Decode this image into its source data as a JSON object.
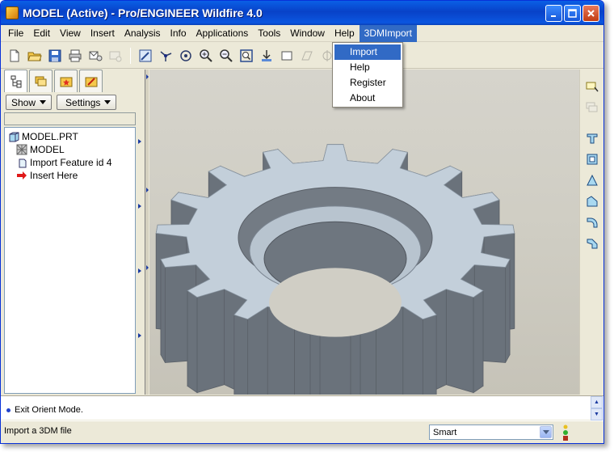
{
  "window": {
    "title": "MODEL (Active) - Pro/ENGINEER Wildfire 4.0",
    "minimize_icon": "minimize-icon",
    "maximize_icon": "maximize-icon",
    "close_icon": "close-icon"
  },
  "menubar": {
    "items": [
      "File",
      "Edit",
      "View",
      "Insert",
      "Analysis",
      "Info",
      "Applications",
      "Tools",
      "Window",
      "Help",
      "3DMImport"
    ],
    "active": "3DMImport"
  },
  "dropdown": {
    "items": [
      "Import",
      "Help",
      "Register",
      "About"
    ],
    "highlighted": "Import"
  },
  "navigator": {
    "show_label": "Show",
    "settings_label": "Settings",
    "tree": [
      {
        "label": "MODEL.PRT",
        "icon": "part-icon"
      },
      {
        "label": "MODEL",
        "icon": "layer-icon"
      },
      {
        "label": "Import Feature id 4",
        "icon": "import-feature-icon"
      },
      {
        "label": "Insert Here",
        "icon": "insert-arrow-icon"
      }
    ]
  },
  "message": {
    "text": "Exit Orient Mode."
  },
  "status": {
    "text": "Import a 3DM file",
    "filter_value": "Smart"
  },
  "colors": {
    "title_blue": "#0842c8",
    "menu_highlight": "#316ac5",
    "gear_top": "#c3cfda",
    "gear_side": "#7a828b",
    "viewport_bg": "#d0cec5"
  }
}
